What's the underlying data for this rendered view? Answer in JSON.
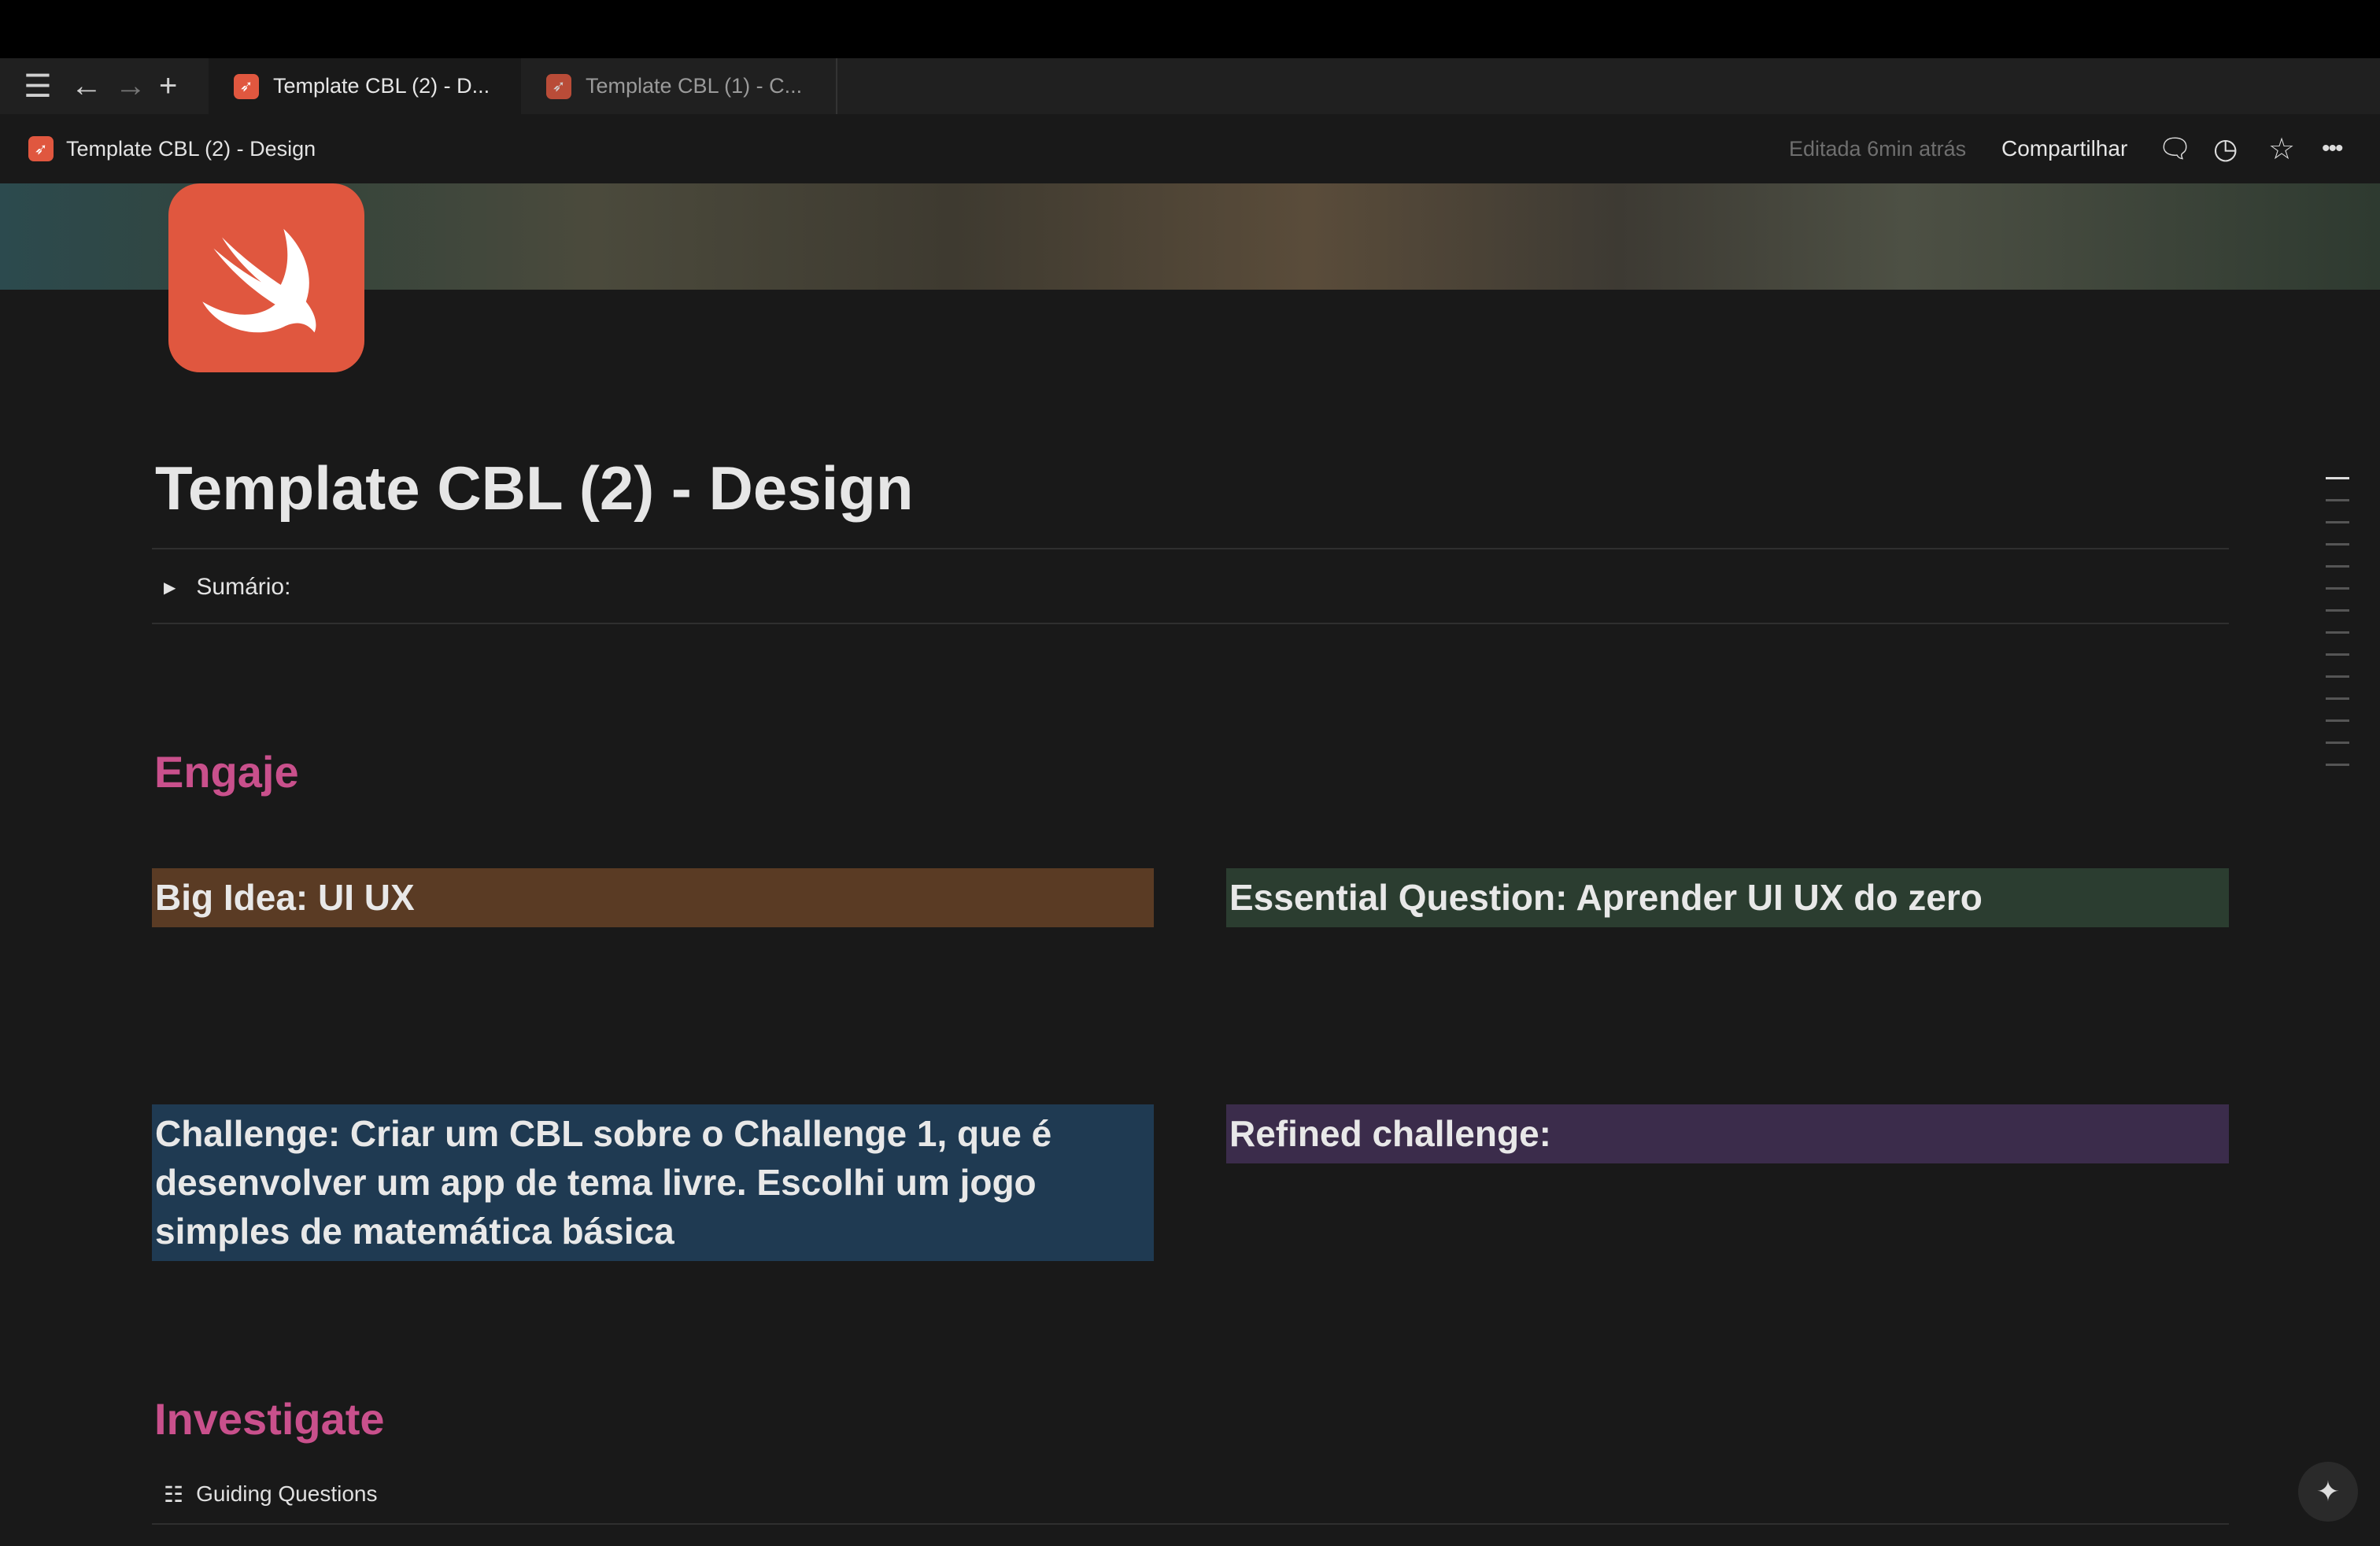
{
  "tabs": [
    {
      "label": "Template CBL (2) - D...",
      "active": true
    },
    {
      "label": "Template CBL (1) - C...",
      "active": false
    }
  ],
  "header": {
    "page_title": "Template CBL (2) - Design",
    "edited": "Editada 6min atrás",
    "share": "Compartilhar"
  },
  "page": {
    "title": "Template CBL (2) - Design",
    "toggle": "Sumário:",
    "sections": [
      {
        "heading": "Engaje"
      },
      {
        "heading": "Investigate"
      }
    ],
    "callouts": {
      "big_idea": "Big Idea: UI UX",
      "essential_question": "Essential Question: Aprender UI UX do zero",
      "challenge": "Challenge:  Criar um CBL sobre o Challenge 1, que é desenvolver um app de tema livre. Escolhi um jogo simples de matemática básica",
      "refined": "Refined challenge:"
    },
    "linked_db": "Guiding Questions"
  },
  "colors": {
    "accent_heading": "#c9508c",
    "big_idea_bg": "#5a3b24",
    "essential_bg": "#2b3d30",
    "challenge_bg": "#1f3a52",
    "refined_bg": "#3b2c4b",
    "swift": "#e0573f"
  }
}
